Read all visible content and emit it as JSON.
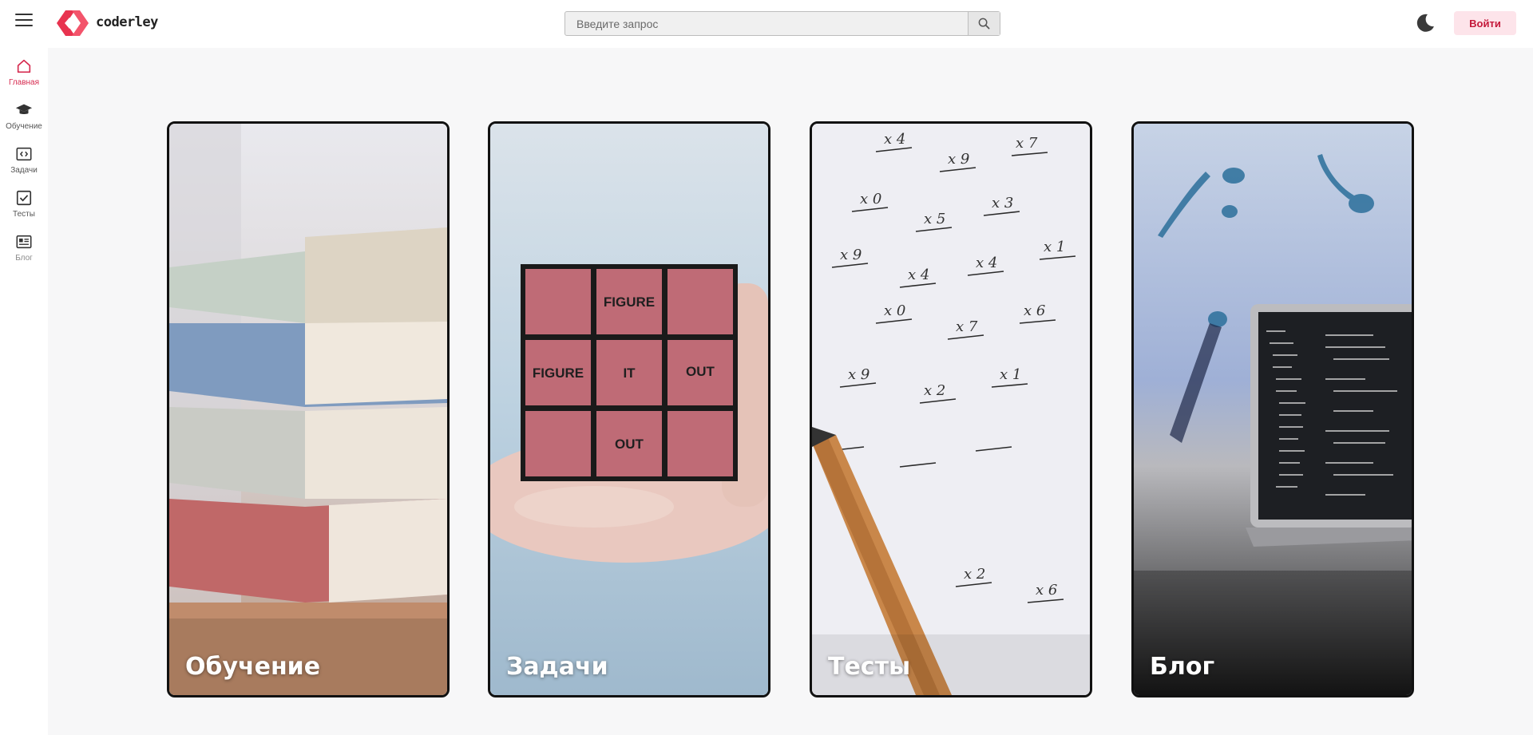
{
  "brand": {
    "name": "coderley",
    "accent": "#e8334f"
  },
  "header": {
    "search_placeholder": "Введите запрос",
    "search_icon": "search-icon",
    "theme_icon": "moon-icon",
    "login_label": "Войти"
  },
  "sidebar": {
    "items": [
      {
        "label": "Главная",
        "icon": "home-icon",
        "active": true
      },
      {
        "label": "Обучение",
        "icon": "graduation-cap-icon"
      },
      {
        "label": "Задачи",
        "icon": "code-icon"
      },
      {
        "label": "Тесты",
        "icon": "checkbox-icon"
      },
      {
        "label": "Блог",
        "icon": "newspaper-icon"
      }
    ]
  },
  "cards": [
    {
      "title": "Обучение",
      "image": "stacked-books"
    },
    {
      "title": "Задачи",
      "image": "puzzle-cube",
      "cube_text": [
        "FIGURE",
        "FIGURE",
        "IT",
        "OUT",
        "OUT"
      ]
    },
    {
      "title": "Тесты",
      "image": "math-worksheet-with-pencil"
    },
    {
      "title": "Блог",
      "image": "laptop-with-code"
    }
  ]
}
